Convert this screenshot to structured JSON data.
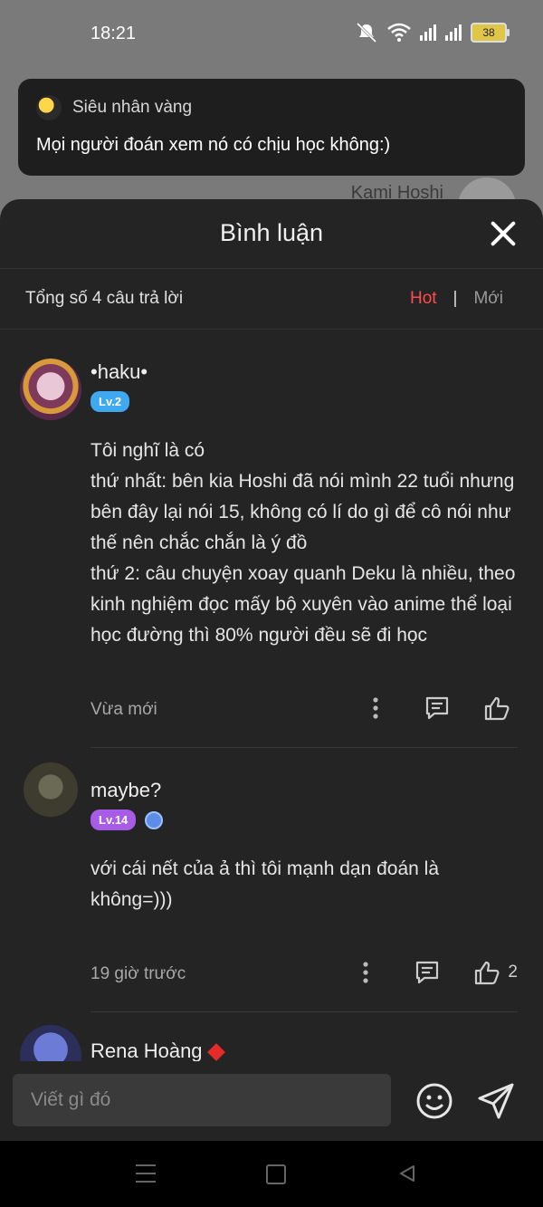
{
  "status_bar": {
    "time": "18:21",
    "battery": "38"
  },
  "background": {
    "author": "Kami Hoshi"
  },
  "toast": {
    "user": "Siêu nhân vàng",
    "message": "Mọi người đoán xem nó có chịu học không:)"
  },
  "sheet": {
    "title": "Bình luận",
    "total": "Tổng số 4 câu trả lời",
    "sort_hot": "Hot",
    "sort_sep": "|",
    "sort_new": "Mới"
  },
  "comments": [
    {
      "name": "•haku•",
      "level": "Lv.2",
      "text": [
        "Tôi nghĩ là có",
        "thứ nhất: bên kia Hoshi đã nói mình 22 tuổi nhưng bên đây lại nói 15, không có lí do gì để cô nói như thế nên chắc chắn là ý đồ",
        "thứ 2: câu chuyện xoay quanh Deku là nhiều, theo kinh nghiệm đọc mấy bộ xuyên vào anime thể loại học đường thì 80% người đều sẽ đi học"
      ],
      "time": "Vừa mới",
      "likes": ""
    },
    {
      "name": "maybe?",
      "level": "Lv.14",
      "text": [
        "với cái nết của ả thì tôi mạnh dạn đoán là không=)))"
      ],
      "time": "19 giờ trước",
      "likes": "2"
    },
    {
      "name": "Rena Hoàng"
    }
  ],
  "input": {
    "placeholder": "Viết gì đó"
  },
  "colors": {
    "accent_hot": "#ff4d4d",
    "level_blue": "#3ea8f0",
    "level_purple": "#a85be6",
    "sheet_bg": "#242424"
  },
  "icons": [
    "mute-icon",
    "wifi-icon",
    "signal-icon",
    "battery-icon",
    "close-icon",
    "more-icon",
    "comment-icon",
    "thumbs-up-icon",
    "emoji-icon",
    "send-icon"
  ]
}
